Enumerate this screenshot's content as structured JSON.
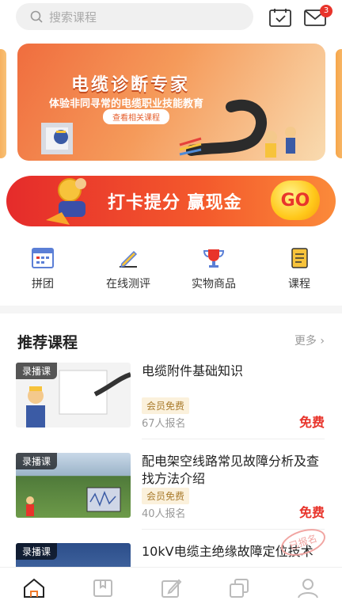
{
  "search": {
    "placeholder": "搜索课程"
  },
  "header": {
    "message_badge": "3"
  },
  "banner": {
    "title": "电缆诊断专家",
    "subtitle": "体验非同寻常的电缆职业技能教育",
    "button": "查看相关课程"
  },
  "checkin": {
    "text": "打卡提分 赢现金",
    "button": "GO"
  },
  "menu": [
    {
      "label": "拼团",
      "icon": "calendar-icon"
    },
    {
      "label": "在线测评",
      "icon": "pencil-icon"
    },
    {
      "label": "实物商品",
      "icon": "trophy-icon"
    },
    {
      "label": "课程",
      "icon": "book-icon"
    }
  ],
  "recommend": {
    "title": "推荐课程",
    "more": "更多"
  },
  "courses": [
    {
      "tag": "录播课",
      "title": "电缆附件基础知识",
      "vip": "会员免费",
      "enroll": "67人报名",
      "price": "免费"
    },
    {
      "tag": "录播课",
      "title": "配电架空线路常见故障分析及查找方法介绍",
      "vip": "会员免费",
      "enroll": "40人报名",
      "price": "免费"
    },
    {
      "tag": "录播课",
      "title": "10kV电缆主绝缘故障定位技术",
      "stamp": "已报名"
    }
  ],
  "colors": {
    "accent": "#e8342b",
    "orange": "#f06d3e",
    "vip_bg": "#fbf1dc"
  }
}
